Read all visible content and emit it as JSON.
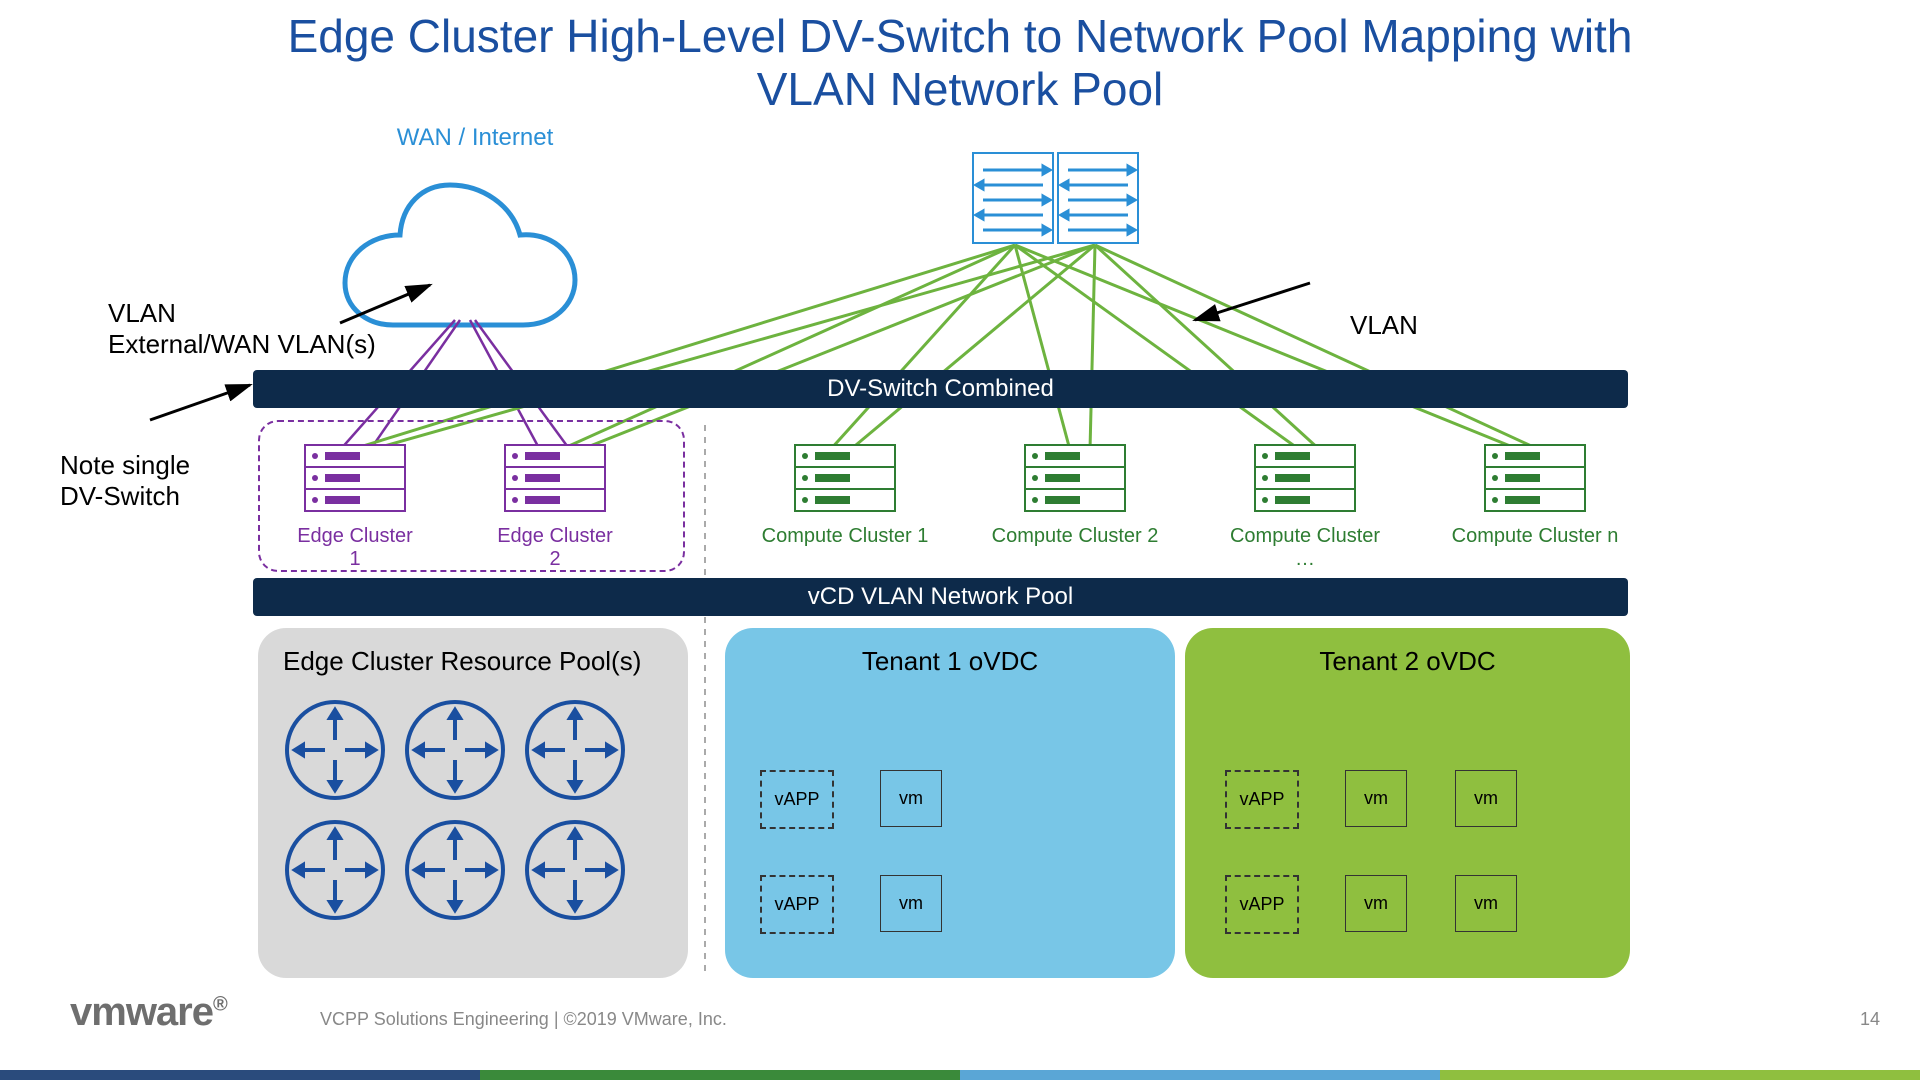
{
  "title_line1": "Edge Cluster High-Level DV-Switch to Network Pool Mapping with",
  "title_line2": "VLAN Network Pool",
  "wan_label": "WAN / Internet",
  "annot_vlan_ext_1": "VLAN",
  "annot_vlan_ext_2": "External/WAN VLAN(s)",
  "annot_note_1": "Note single",
  "annot_note_2": "DV-Switch",
  "annot_vlan_right": "VLAN",
  "bar_dvswitch": "DV-Switch Combined",
  "bar_pool": "vCD VLAN Network Pool",
  "clusters": {
    "edge1": "Edge Cluster 1",
    "edge2": "Edge Cluster 2",
    "compute1": "Compute Cluster 1",
    "compute2": "Compute Cluster 2",
    "compute3": "Compute Cluster …",
    "compute4": "Compute Cluster n"
  },
  "panels": {
    "edge_pool": "Edge Cluster Resource Pool(s)",
    "tenant1": "Tenant 1 oVDC",
    "tenant2": "Tenant 2 oVDC"
  },
  "vapp_label": "vAPP",
  "vm_label": "vm",
  "footer": {
    "logo": "vmware",
    "text": "VCPP Solutions Engineering   |   ©2019 VMware, Inc.",
    "page": "14"
  }
}
